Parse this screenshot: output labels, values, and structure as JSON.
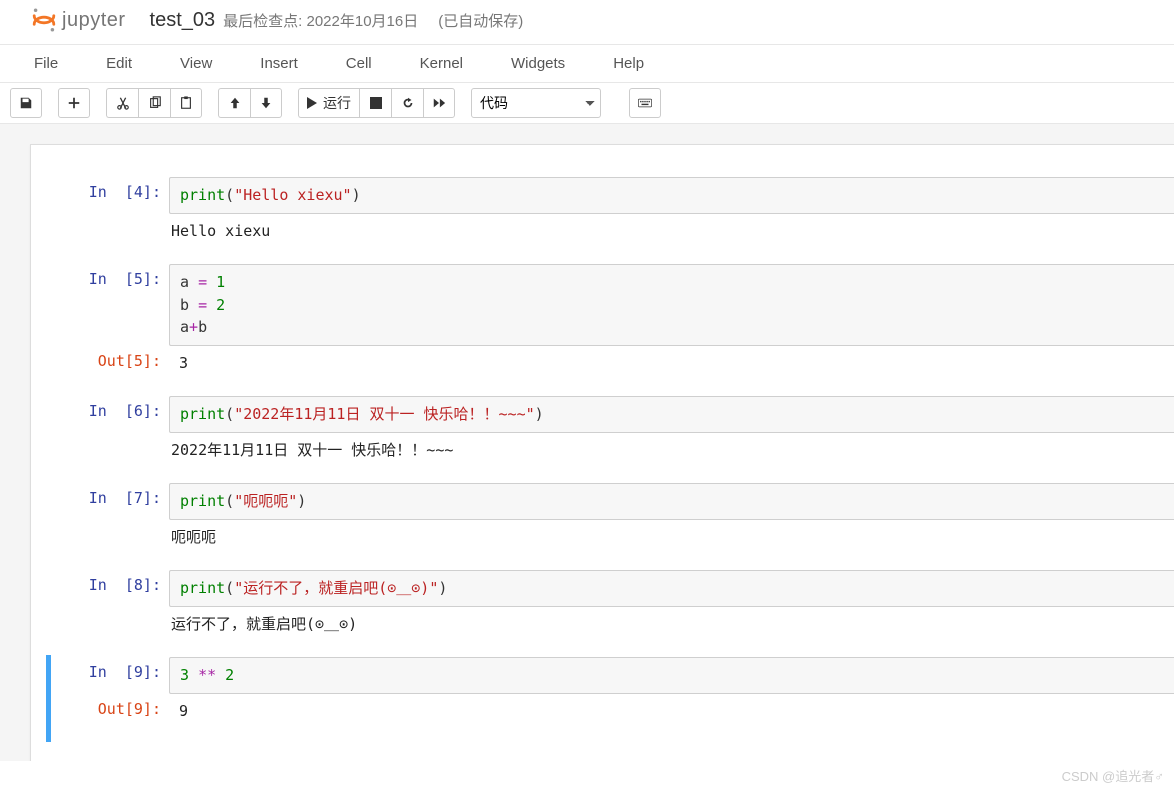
{
  "brand": {
    "name": "jupyter"
  },
  "header": {
    "title": "test_03",
    "checkpoint_full": "最后检查点: 2022年10月16日",
    "autosave": "(已自动保存)"
  },
  "menu": {
    "items": [
      "File",
      "Edit",
      "View",
      "Insert",
      "Cell",
      "Kernel",
      "Widgets",
      "Help"
    ]
  },
  "toolbar": {
    "run_label": "运行",
    "celltype_selected": "代码"
  },
  "cells": [
    {
      "in_prompt": "In  [4]:",
      "code_tokens": [
        [
          "builtin",
          "print"
        ],
        [
          "plain",
          "("
        ],
        [
          "string",
          "\"Hello xiexu\""
        ],
        [
          "plain",
          ")"
        ]
      ],
      "stdout": "Hello xiexu"
    },
    {
      "in_prompt": "In  [5]:",
      "code_lines_tokens": [
        [
          [
            "plain",
            "a "
          ],
          [
            "op",
            "="
          ],
          [
            "plain",
            " "
          ],
          [
            "num",
            "1"
          ]
        ],
        [
          [
            "plain",
            "b "
          ],
          [
            "op",
            "="
          ],
          [
            "plain",
            " "
          ],
          [
            "num",
            "2"
          ]
        ],
        [
          [
            "plain",
            "a"
          ],
          [
            "op",
            "+"
          ],
          [
            "plain",
            "b"
          ]
        ]
      ],
      "out_prompt": "Out[5]:",
      "out_value": "3"
    },
    {
      "in_prompt": "In  [6]:",
      "code_tokens": [
        [
          "builtin",
          "print"
        ],
        [
          "plain",
          "("
        ],
        [
          "string",
          "\"2022年11月11日 双十一 快乐哈！！~~~\""
        ],
        [
          "plain",
          ")"
        ]
      ],
      "stdout": "2022年11月11日 双十一 快乐哈！！~~~"
    },
    {
      "in_prompt": "In  [7]:",
      "code_tokens": [
        [
          "builtin",
          "print"
        ],
        [
          "plain",
          "("
        ],
        [
          "string",
          "\"呃呃呃\""
        ],
        [
          "plain",
          ")"
        ]
      ],
      "stdout": "呃呃呃"
    },
    {
      "in_prompt": "In  [8]:",
      "code_tokens": [
        [
          "builtin",
          "print"
        ],
        [
          "plain",
          "("
        ],
        [
          "string",
          "\"运行不了，就重启吧(⊙＿⊙)\""
        ],
        [
          "plain",
          ")"
        ]
      ],
      "stdout": "运行不了，就重启吧(⊙＿⊙)"
    },
    {
      "selected": true,
      "in_prompt": "In  [9]:",
      "code_tokens": [
        [
          "num",
          "3"
        ],
        [
          "plain",
          " "
        ],
        [
          "op",
          "**"
        ],
        [
          "plain",
          " "
        ],
        [
          "num",
          "2"
        ]
      ],
      "out_prompt": "Out[9]:",
      "out_value": "9"
    }
  ],
  "watermark": "CSDN @追光者♂"
}
